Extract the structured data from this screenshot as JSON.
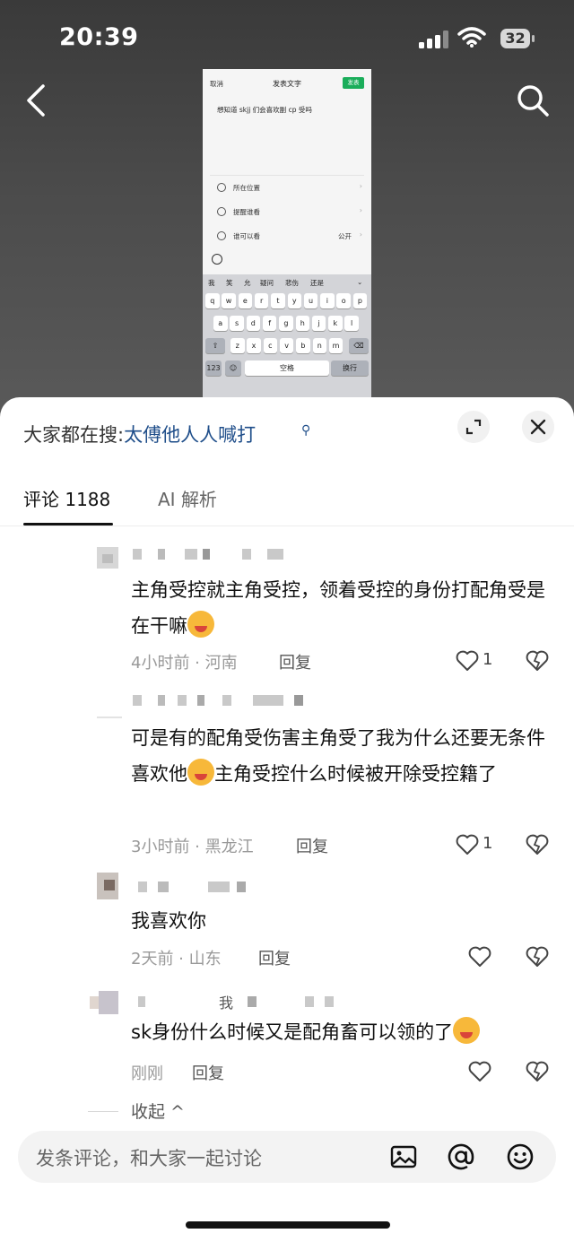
{
  "status_bar": {
    "time": "20:39",
    "battery": "32"
  },
  "nav": {
    "back_icon": "chevron-left-icon",
    "search_icon": "search-icon"
  },
  "embedded_screenshot": {
    "cancel": "取消",
    "title": "发表文字",
    "publish": "发表",
    "text": "想知道 skjj 们会喜欢副 cp 受吗",
    "rows": [
      {
        "label": "所在位置",
        "value": ""
      },
      {
        "label": "提醒谁看",
        "value": ""
      },
      {
        "label": "谁可以看",
        "value": "公开"
      }
    ],
    "candidates": [
      "我",
      "笑",
      "允",
      "疑问",
      "悲伤",
      "还是"
    ],
    "keyboard_rows": [
      [
        "q",
        "w",
        "e",
        "r",
        "t",
        "y",
        "u",
        "i",
        "o",
        "p"
      ],
      [
        "a",
        "s",
        "d",
        "f",
        "g",
        "h",
        "j",
        "k",
        "l"
      ],
      [
        "z",
        "x",
        "c",
        "v",
        "b",
        "n",
        "m"
      ]
    ],
    "key_123": "123",
    "key_space": "空格",
    "key_return": "换行"
  },
  "sheet": {
    "hot_search_prefix": "大家都在搜:",
    "hot_search_keyword": "太傅他人人喊打",
    "tabs": [
      {
        "label": "评论 1188",
        "active": true
      },
      {
        "label": "AI 解析",
        "active": false
      }
    ],
    "comments": [
      {
        "text": "主角受控就主角受控，领着受控的身份打配角受是在干嘛",
        "emoji": "lipstick-face",
        "time": "4小时前 · 河南",
        "reply": "回复",
        "likes": "1"
      },
      {
        "text_a": "可是有的配角受伤害主角受了我为什么还要无条件喜欢他",
        "emoji": "tears-of-joy",
        "text_b": "主角受控什么时候被开除受控籍了",
        "time": "3小时前 · 黑龙江",
        "reply": "回复",
        "likes": "1"
      },
      {
        "text": "我喜欢你",
        "time": "2天前 · 山东",
        "reply": "回复",
        "likes": ""
      },
      {
        "name_fragment": "我",
        "text": "sk身份什么时候又是配角畜可以领的了",
        "emoji": "lipstick-face",
        "time": "刚刚",
        "reply": "回复",
        "likes": ""
      }
    ],
    "collapse": "收起 ^",
    "input_placeholder": "发条评论，和大家一起讨论"
  }
}
